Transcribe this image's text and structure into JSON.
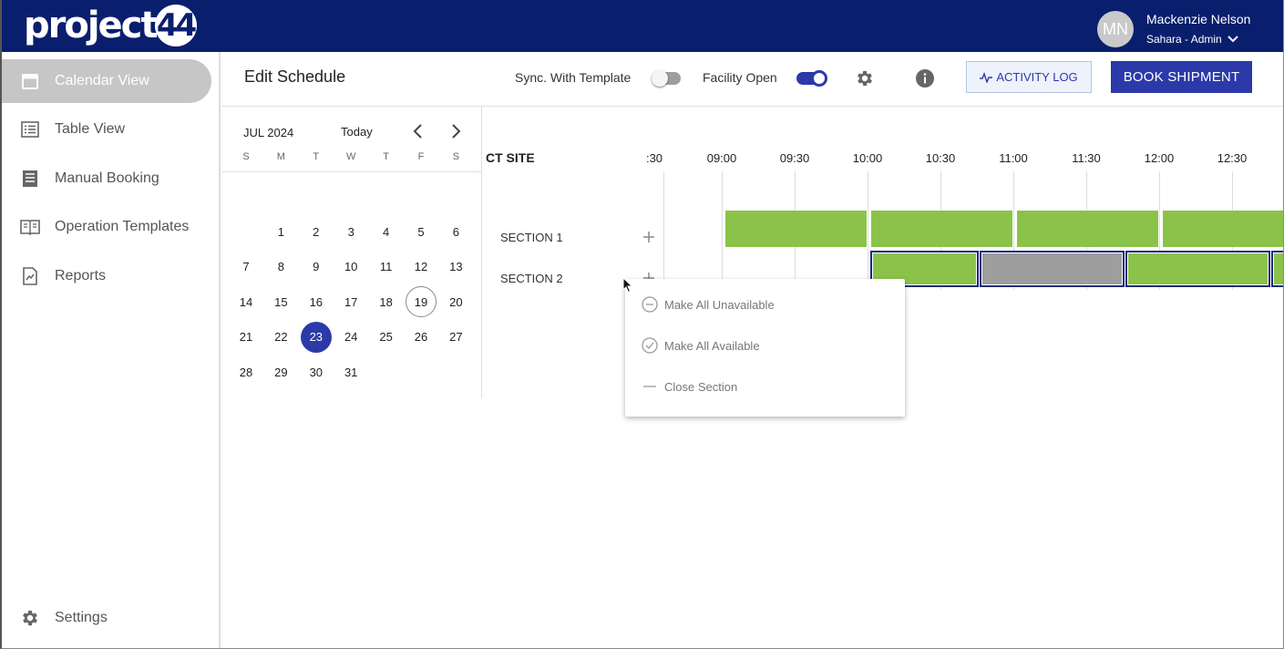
{
  "header": {
    "logo_text": "project",
    "logo_number": "44",
    "avatar_initials": "MN",
    "user_name": "Mackenzie Nelson",
    "user_role": "Sahara - Admin"
  },
  "sidebar": {
    "items": [
      {
        "label": "Calendar View",
        "icon": "calendar-icon"
      },
      {
        "label": "Table View",
        "icon": "list-icon"
      },
      {
        "label": "Manual Booking",
        "icon": "document-icon"
      },
      {
        "label": "Operation Templates",
        "icon": "book-icon"
      },
      {
        "label": "Reports",
        "icon": "report-icon"
      }
    ],
    "settings_label": "Settings"
  },
  "toolbar": {
    "title": "Edit Schedule",
    "sync_label": "Sync. With Template",
    "sync_on": false,
    "facility_label": "Facility Open",
    "facility_on": true,
    "activity_log_label": "ACTIVITY LOG",
    "book_shipment_label": "BOOK SHIPMENT"
  },
  "calendar": {
    "month_label": "JUL 2024",
    "today_label": "Today",
    "weekdays": [
      "S",
      "M",
      "T",
      "W",
      "T",
      "F",
      "S"
    ],
    "weeks": [
      [
        "",
        "1",
        "2",
        "3",
        "4",
        "5",
        "6"
      ],
      [
        "7",
        "8",
        "9",
        "10",
        "11",
        "12",
        "13"
      ],
      [
        "14",
        "15",
        "16",
        "17",
        "18",
        "19",
        "20"
      ],
      [
        "21",
        "22",
        "23",
        "24",
        "25",
        "26",
        "27"
      ],
      [
        "28",
        "29",
        "30",
        "31",
        "",
        "",
        ""
      ]
    ],
    "today_day": "19",
    "selected_day": "23"
  },
  "schedule": {
    "site_label": "CT SITE",
    "times": [
      ":30",
      "09:00",
      "09:30",
      "10:00",
      "10:30",
      "11:00",
      "11:30",
      "12:00",
      "12:30"
    ],
    "sections": [
      {
        "label": "SECTION 1"
      },
      {
        "label": "SECTION 2"
      }
    ],
    "slot_colors": {
      "available": "#8bc34a",
      "unavailable": "#9e9e9e",
      "selected_border": "#1e2a7a"
    }
  },
  "context_menu": {
    "items": [
      {
        "label": "Make All Unavailable",
        "icon": "minus-circle-icon"
      },
      {
        "label": "Make All Available",
        "icon": "check-circle-icon"
      },
      {
        "label": "Close Section",
        "icon": "minus-icon"
      }
    ]
  }
}
